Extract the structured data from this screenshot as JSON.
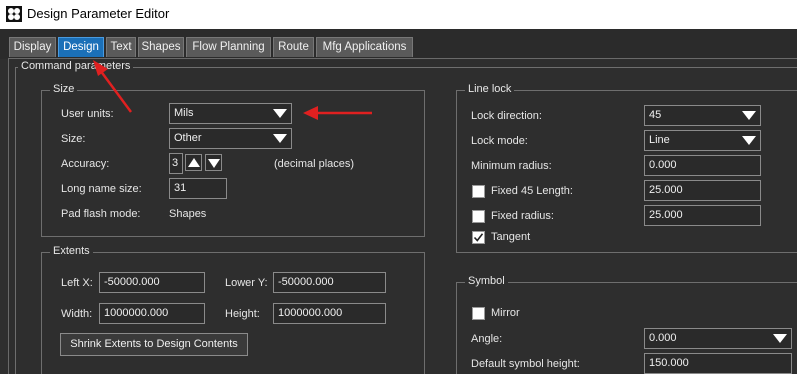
{
  "window": {
    "title": "Design Parameter Editor"
  },
  "tabs": [
    {
      "label": "Display"
    },
    {
      "label": "Design"
    },
    {
      "label": "Text"
    },
    {
      "label": "Shapes"
    },
    {
      "label": "Flow Planning"
    },
    {
      "label": "Route"
    },
    {
      "label": "Mfg Applications"
    }
  ],
  "active_tab": "Design",
  "command_parameters": {
    "label": "Command parameters"
  },
  "size_group": {
    "label": "Size",
    "user_units_label": "User units:",
    "user_units_value": "Mils",
    "size_label": "Size:",
    "size_value": "Other",
    "accuracy_label": "Accuracy:",
    "accuracy_value": "3",
    "accuracy_suffix": "(decimal places)",
    "long_name_size_label": "Long name size:",
    "long_name_size_value": "31",
    "pad_flash_mode_label": "Pad flash mode:",
    "pad_flash_mode_value": "Shapes"
  },
  "extents_group": {
    "label": "Extents",
    "left_x_label": "Left X:",
    "left_x_value": "-50000.000",
    "lower_y_label": "Lower Y:",
    "lower_y_value": "-50000.000",
    "width_label": "Width:",
    "width_value": "1000000.000",
    "height_label": "Height:",
    "height_value": "1000000.000",
    "shrink_button_label": "Shrink Extents to Design Contents"
  },
  "line_lock_group": {
    "label": "Line lock",
    "lock_direction_label": "Lock direction:",
    "lock_direction_value": "45",
    "lock_mode_label": "Lock mode:",
    "lock_mode_value": "Line",
    "minimum_radius_label": "Minimum radius:",
    "minimum_radius_value": "0.000",
    "fixed_45_length_label": "Fixed 45 Length:",
    "fixed_45_length_checked": false,
    "fixed_45_length_value": "25.000",
    "fixed_radius_label": "Fixed radius:",
    "fixed_radius_checked": false,
    "fixed_radius_value": "25.000",
    "tangent_label": "Tangent",
    "tangent_checked": true
  },
  "symbol_group": {
    "label": "Symbol",
    "mirror_label": "Mirror",
    "mirror_checked": false,
    "angle_label": "Angle:",
    "angle_value": "0.000",
    "default_symbol_height_label": "Default symbol height:",
    "default_symbol_height_value": "150.000"
  },
  "colors": {
    "background": "#2f2f2f",
    "active_tab": "#1b70b8",
    "annotation_arrow": "#e02020"
  }
}
